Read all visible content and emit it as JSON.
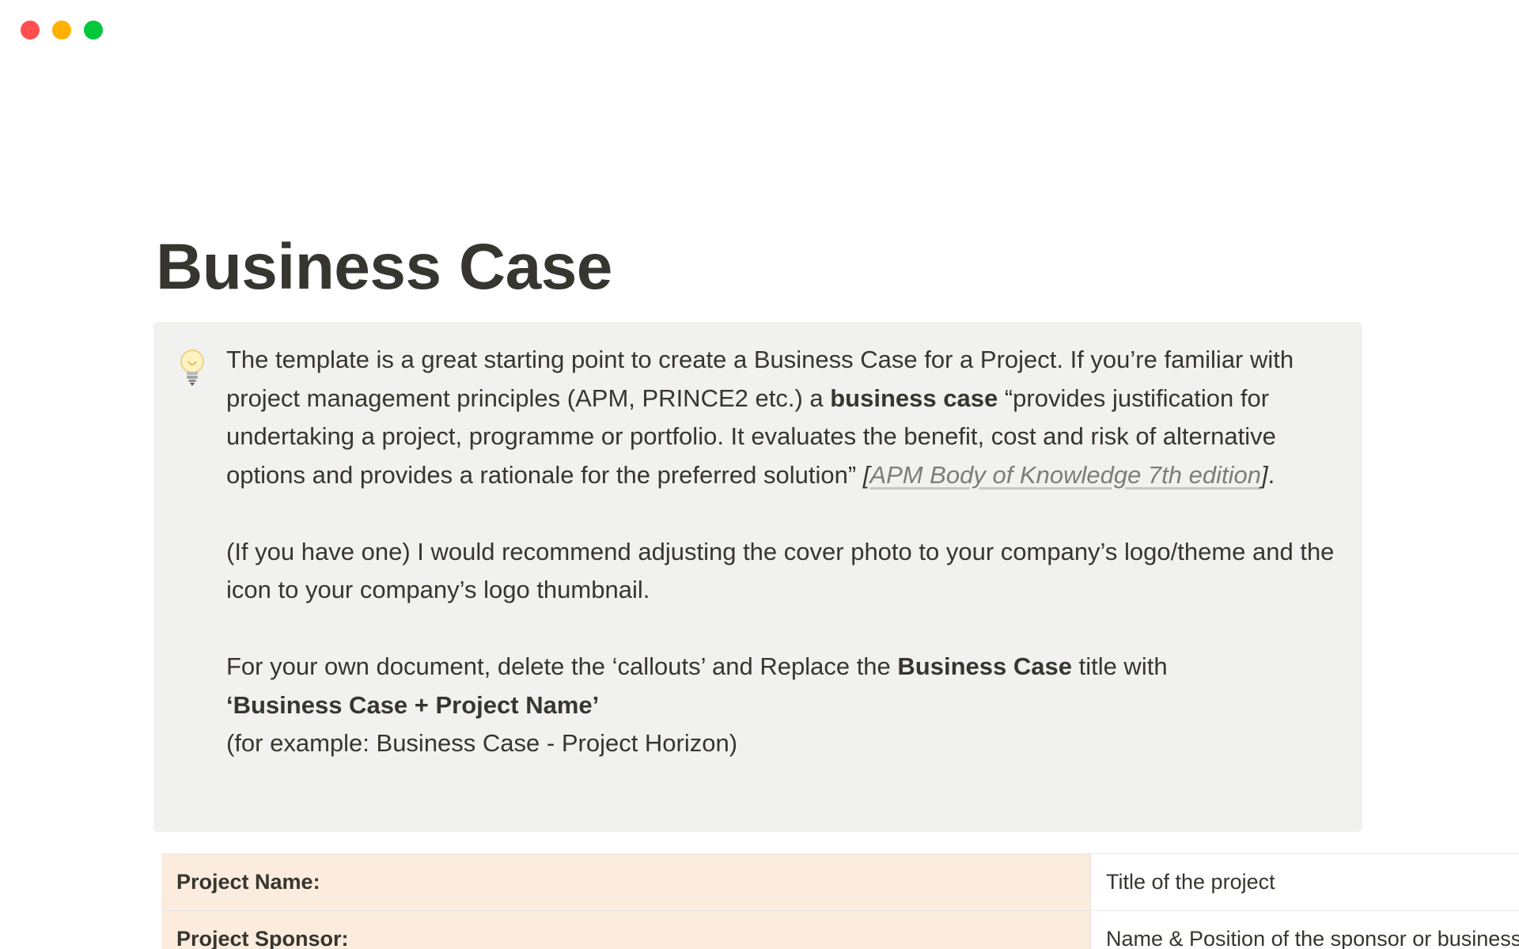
{
  "window": {
    "controls": {
      "close_color": "#ff4f4f",
      "minimize_color": "#ffb000",
      "zoom_color": "#00c83a"
    }
  },
  "page": {
    "title": "Business Case"
  },
  "callout": {
    "icon": "lightbulb-icon",
    "background": "#f1f1ef",
    "paragraph1": {
      "part1": "The template is a great starting point to create a Business Case for a Project. If you’re familiar with project management principles (APM, PRINCE2 etc.) a ",
      "bold": "business case",
      "part2": " “provides justification for undertaking a project, programme or portfolio. It evaluates the benefit, cost and risk of alternative options and provides a rationale for the preferred solution” ",
      "bracket_open": "[",
      "link_text": "APM Body of Knowledge 7th edition",
      "bracket_close": "]",
      "end": "."
    },
    "paragraph2": "(If you have one) I would recommend adjusting the cover photo to your company’s logo/theme and the icon to your company’s logo thumbnail.",
    "paragraph3": {
      "part1": "For your own document, delete the ‘callouts’ and Replace the ",
      "bold1": "Business Case",
      "part2": " title with",
      "bold2": "‘Business Case + Project Name’",
      "line3": "(for example: Business Case - Project Horizon)"
    }
  },
  "table": {
    "label_background": "#fbecdd",
    "rows": [
      {
        "label": "Project Name:",
        "value": "Title of the project"
      },
      {
        "label": "Project Sponsor:",
        "value": "Name & Position of the sponsor or business owner"
      }
    ]
  }
}
